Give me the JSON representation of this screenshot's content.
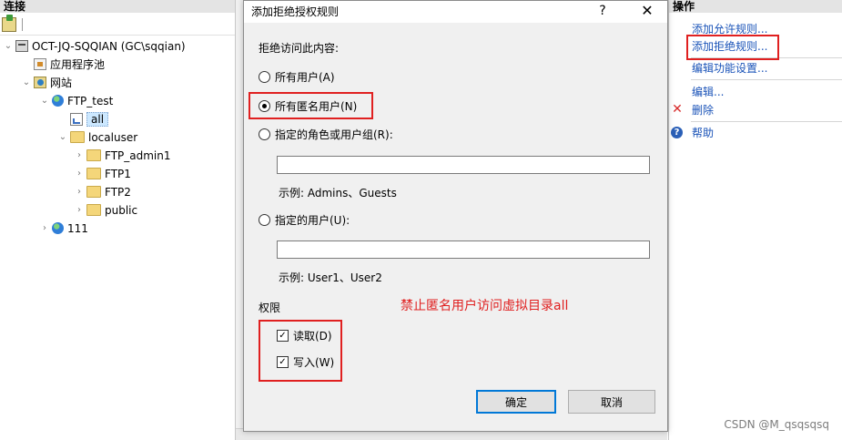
{
  "colors": {
    "accent_red": "#e02020",
    "link_blue": "#1a53b8",
    "dialog_bg": "#f0f0f0"
  },
  "left_pane": {
    "header": "连接",
    "tree": [
      {
        "label": "OCT-JQ-SQQIAN (GC\\sqqian)",
        "icon": "server-icon"
      },
      {
        "label": "应用程序池",
        "icon": "app-pool-icon"
      },
      {
        "label": "网站",
        "icon": "sites-icon"
      },
      {
        "label": "FTP_test",
        "icon": "globe-icon"
      },
      {
        "label": "all",
        "icon": "virtual-directory-icon"
      },
      {
        "label": "localuser",
        "icon": "folder-icon"
      },
      {
        "label": "FTP_admin1",
        "icon": "folder-icon"
      },
      {
        "label": "FTP1",
        "icon": "folder-icon"
      },
      {
        "label": "FTP2",
        "icon": "folder-icon"
      },
      {
        "label": "public",
        "icon": "folder-icon"
      },
      {
        "label": "111",
        "icon": "globe-icon"
      }
    ]
  },
  "right_pane": {
    "header": "操作",
    "actions": [
      {
        "label": "添加允许规则..."
      },
      {
        "label": "添加拒绝规则..."
      },
      {
        "label": "编辑功能设置..."
      },
      {
        "label": "编辑..."
      },
      {
        "label": "删除",
        "icon": "delete-icon"
      },
      {
        "label": "帮助",
        "icon": "help-icon"
      }
    ]
  },
  "dialog": {
    "title": "添加拒绝授权规则",
    "help_glyph": "?",
    "close_glyph": "✕",
    "deny_access_label": "拒绝访问此内容:",
    "options": {
      "all_users": "所有用户(A)",
      "all_anonymous": "所有匿名用户(N)",
      "roles_groups": "指定的角色或用户组(R):",
      "roles_example": "示例: Admins、Guests",
      "users": "指定的用户(U):",
      "users_example": "示例: User1、User2"
    },
    "selected_option": "all_anonymous",
    "roles_value": "",
    "users_value": "",
    "permissions_label": "权限",
    "permissions": {
      "read": {
        "label": "读取(D)",
        "checked": true
      },
      "write": {
        "label": "写入(W)",
        "checked": true
      }
    },
    "ok_label": "确定",
    "cancel_label": "取消"
  },
  "annotation": "禁止匿名用户访问虚拟目录all",
  "watermark": "CSDN @M_qsqsqsq"
}
